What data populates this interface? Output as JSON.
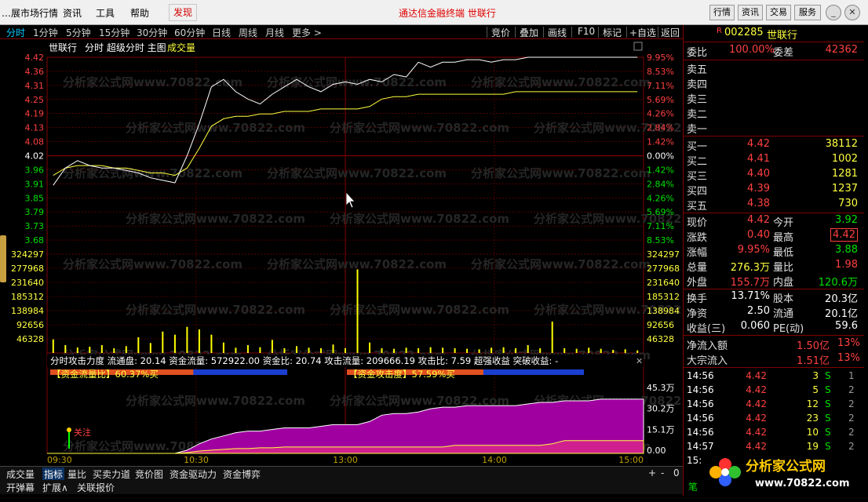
{
  "menu": {
    "items": [
      "…展市场行情",
      "资讯",
      "工具",
      "帮助"
    ],
    "warning": "发现",
    "center_title": "通达信金融终端  世联行",
    "right_buttons": [
      "行情",
      "资讯",
      "交易",
      "服务"
    ]
  },
  "periods": [
    "分时",
    "1分钟",
    "5分钟",
    "15分钟",
    "30分钟",
    "60分钟",
    "日线",
    "周线",
    "月线",
    "更多 >"
  ],
  "active_period": "分时",
  "tools": [
    "竞价",
    "叠加",
    "画线",
    "F10",
    "标记",
    "+自选",
    "返回"
  ],
  "chart": {
    "header_name": "世联行",
    "header_modes": "分时 超级分时 主图",
    "header_volume": "成交量",
    "price_ticks": [
      "4.42",
      "4.36",
      "4.31",
      "4.25",
      "4.19",
      "4.13",
      "4.08",
      "4.02",
      "3.96",
      "3.91",
      "3.85",
      "3.79",
      "3.73",
      "3.68"
    ],
    "pct_ticks": [
      "9.95%",
      "8.53%",
      "7.11%",
      "5.69%",
      "4.26%",
      "2.84%",
      "1.42%",
      "0.00%",
      "1.42%",
      "2.84%",
      "4.26%",
      "5.69%",
      "7.11%",
      "8.53%"
    ],
    "volume_ticks": [
      "324297",
      "277968",
      "231640",
      "185312",
      "138984",
      "92656",
      "46328"
    ],
    "time_ticks": [
      "09:30",
      "10:30",
      "13:00",
      "14:00",
      "15:00"
    ]
  },
  "chart_data": {
    "type": "line",
    "prev_close": 4.02,
    "ylim": [
      3.62,
      4.42
    ],
    "series": [
      {
        "values": [
          3.9,
          3.97,
          4.0,
          3.98,
          3.97,
          3.97,
          3.96,
          3.95,
          3.93,
          3.92,
          3.91,
          4.02,
          4.15,
          4.3,
          4.33,
          4.28,
          4.25,
          4.23,
          4.27,
          4.3,
          4.33,
          4.3,
          4.28,
          4.31,
          4.32,
          4.31,
          4.33,
          4.32,
          4.35,
          4.34,
          4.4,
          4.38,
          4.4,
          4.4,
          4.41,
          4.41,
          4.4,
          4.41,
          4.41,
          4.42,
          4.42,
          4.42,
          4.42,
          4.42,
          4.42,
          4.42,
          4.42,
          4.42,
          4.42
        ]
      },
      {
        "values": [
          3.94,
          3.97,
          3.98,
          3.98,
          3.98,
          3.97,
          3.97,
          3.96,
          3.95,
          3.95,
          3.94,
          3.97,
          4.05,
          4.14,
          4.17,
          4.18,
          4.18,
          4.19,
          4.19,
          4.2,
          4.2,
          4.2,
          4.21,
          4.21,
          4.21,
          4.21,
          4.22,
          4.25,
          4.26,
          4.26,
          4.27,
          4.27,
          4.27,
          4.27,
          4.27,
          4.27,
          4.27,
          4.27,
          4.28,
          4.28,
          4.28,
          4.28,
          4.28,
          4.28,
          4.28,
          4.28,
          4.28,
          4.28,
          4.28
        ]
      }
    ],
    "volume": [
      52000,
      30000,
      21000,
      24000,
      30000,
      18000,
      26000,
      60000,
      38000,
      82000,
      70000,
      100000,
      90000,
      70000,
      40000,
      20000,
      30000,
      22000,
      50000,
      18000,
      26000,
      20000,
      18000,
      32000,
      18000,
      320000,
      40000,
      18000,
      16000,
      20000,
      18000,
      22000,
      20000,
      18000,
      16000,
      14000,
      20000,
      22000,
      18000,
      30000,
      18000,
      120000,
      18000,
      16000,
      20000,
      16000,
      12000,
      14000,
      10000
    ],
    "indicator_series": [
      {
        "values": [
          0,
          0,
          0,
          0,
          0,
          0,
          0,
          0,
          0,
          0,
          0,
          2,
          6,
          9,
          11,
          13,
          14,
          14,
          15,
          16,
          16,
          16,
          17,
          18,
          18,
          18,
          20,
          24,
          25,
          25,
          26,
          28,
          29,
          29,
          30,
          30,
          30,
          30,
          30,
          31,
          32,
          32,
          33,
          33,
          33,
          34,
          34,
          34,
          34
        ]
      },
      {
        "values": [
          0,
          0,
          0,
          0,
          0,
          0,
          0,
          0,
          0,
          0,
          0,
          0.5,
          1.5,
          2,
          2.5,
          3,
          3,
          3.5,
          3.5,
          4,
          4,
          4,
          4,
          4,
          4,
          4,
          4,
          4,
          4,
          4,
          4,
          4,
          4,
          5,
          5,
          5,
          5,
          5,
          5,
          5,
          5,
          6,
          8,
          8,
          8,
          8,
          8,
          8,
          8
        ]
      }
    ],
    "indicator_ylim": [
      0,
      45.3
    ]
  },
  "indicator": {
    "header": "分时攻击力度  流通盘: 20.14  资金流量: 572922.00  资金比: 20.74  攻击流量: 209666.19  攻击比: 7.59  超强收益  突破收益: -",
    "flow_ratio_label": "【资金流量比】60.37%买",
    "attack_label": "【资金攻击度】57.59%买",
    "marker": "关注",
    "right_ticks": [
      "45.3万",
      "30.2万",
      "15.1万",
      "0.00"
    ],
    "watermark": "分析家公式网www.70822.com"
  },
  "bottom_tabs": [
    "成交量",
    "指标",
    "量比",
    "买卖力道",
    "竞价图",
    "资金驱动力",
    "资金博弈"
  ],
  "bottom_tabs2": [
    "开弹幕",
    "扩展∧",
    "关联报价"
  ],
  "bottom_right": [
    "+",
    "-",
    "0"
  ],
  "quote": {
    "code": "002285",
    "name": "世联行",
    "committee": {
      "label": "委比",
      "value": "100.00%",
      "label2": "委差",
      "value2": "42362"
    },
    "sells": [
      {
        "label": "卖五"
      },
      {
        "label": "卖四"
      },
      {
        "label": "卖三"
      },
      {
        "label": "卖二"
      },
      {
        "label": "卖一"
      }
    ],
    "buys": [
      {
        "label": "买一",
        "price": "4.42",
        "vol": "38112"
      },
      {
        "label": "买二",
        "price": "4.41",
        "vol": "1002"
      },
      {
        "label": "买三",
        "price": "4.40",
        "vol": "1281"
      },
      {
        "label": "买四",
        "price": "4.39",
        "vol": "1237"
      },
      {
        "label": "买五",
        "price": "4.38",
        "vol": "730"
      }
    ],
    "stats": [
      {
        "l1": "现价",
        "v1": "4.42",
        "c1": "red",
        "l2": "今开",
        "v2": "3.92",
        "c2": "green"
      },
      {
        "l1": "涨跌",
        "v1": "0.40",
        "c1": "red",
        "l2": "最高",
        "v2": "4.42",
        "c2": "red"
      },
      {
        "l1": "涨幅",
        "v1": "9.95%",
        "c1": "red",
        "l2": "最低",
        "v2": "3.88",
        "c2": "green"
      },
      {
        "l1": "总量",
        "v1": "276.3万",
        "c1": "yellow",
        "l2": "量比",
        "v2": "1.98",
        "c2": "red"
      },
      {
        "l1": "外盘",
        "v1": "155.7万",
        "c1": "red",
        "l2": "内盘",
        "v2": "120.6万",
        "c2": "green"
      }
    ],
    "stats2": [
      {
        "l1": "换手",
        "v1": "13.71%",
        "l2": "股本",
        "v2": "20.3亿"
      },
      {
        "l1": "净资",
        "v1": "2.50",
        "l2": "流通",
        "v2": "20.1亿"
      },
      {
        "l1": "收益(三)",
        "v1": "0.060",
        "l2": "PE(动)",
        "v2": "59.6"
      }
    ],
    "flows": [
      {
        "label": "净流入额",
        "value": "1.50亿",
        "pct": "13%"
      },
      {
        "label": "大宗流入",
        "value": "1.51亿",
        "pct": "13%"
      }
    ],
    "ticks": [
      {
        "time": "14:56",
        "price": "4.42",
        "vol": "3",
        "side": "S",
        "n": "1"
      },
      {
        "time": "14:56",
        "price": "4.42",
        "vol": "5",
        "side": "S",
        "n": "2"
      },
      {
        "time": "14:56",
        "price": "4.42",
        "vol": "12",
        "side": "S",
        "n": "2"
      },
      {
        "time": "14:56",
        "price": "4.42",
        "vol": "23",
        "side": "S",
        "n": "2"
      },
      {
        "time": "14:56",
        "price": "4.42",
        "vol": "10",
        "side": "S",
        "n": "2"
      },
      {
        "time": "14:57",
        "price": "4.42",
        "vol": "19",
        "side": "S",
        "n": "2"
      },
      {
        "time": "15:",
        "price": "",
        "vol": "",
        "side": "",
        "n": ""
      }
    ],
    "bottom_note": "笔"
  },
  "logo": {
    "text": "分析家公式网",
    "url": "www.70822.com"
  },
  "colors": {
    "price_line": "#ffffff",
    "avg_line": "#ffff40",
    "volume_bar": "#ffff00",
    "indicator_fill": "#a000a0",
    "grid": "#800000"
  }
}
